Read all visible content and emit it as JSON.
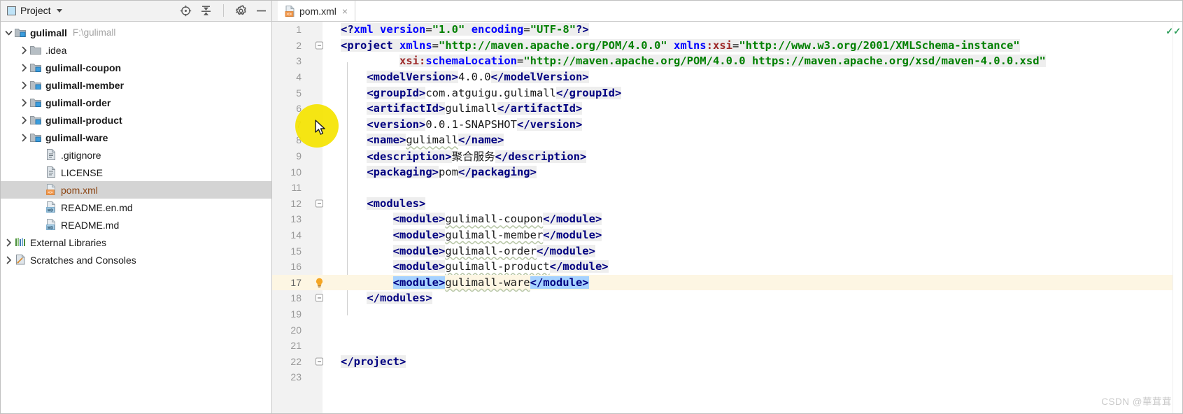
{
  "sidebar": {
    "header": {
      "title": "Project",
      "icons": [
        "locate-icon",
        "collapse-all-icon",
        "gear-icon",
        "minimize-icon"
      ]
    },
    "items": [
      {
        "label": "gulimall",
        "path": "F:\\gulimall",
        "icon": "module-folder-icon",
        "arrow": "expanded",
        "depth": 0,
        "bold": true,
        "selected": false
      },
      {
        "label": ".idea",
        "path": "",
        "icon": "folder-icon",
        "arrow": "collapsed",
        "depth": 1,
        "bold": false,
        "selected": false
      },
      {
        "label": "gulimall-coupon",
        "path": "",
        "icon": "module-folder-icon",
        "arrow": "collapsed",
        "depth": 1,
        "bold": true,
        "selected": false
      },
      {
        "label": "gulimall-member",
        "path": "",
        "icon": "module-folder-icon",
        "arrow": "collapsed",
        "depth": 1,
        "bold": true,
        "selected": false
      },
      {
        "label": "gulimall-order",
        "path": "",
        "icon": "module-folder-icon",
        "arrow": "collapsed",
        "depth": 1,
        "bold": true,
        "selected": false
      },
      {
        "label": "gulimall-product",
        "path": "",
        "icon": "module-folder-icon",
        "arrow": "collapsed",
        "depth": 1,
        "bold": true,
        "selected": false
      },
      {
        "label": "gulimall-ware",
        "path": "",
        "icon": "module-folder-icon",
        "arrow": "collapsed",
        "depth": 1,
        "bold": true,
        "selected": false
      },
      {
        "label": ".gitignore",
        "path": "",
        "icon": "text-file-icon",
        "arrow": "none",
        "depth": 2,
        "bold": false,
        "selected": false
      },
      {
        "label": "LICENSE",
        "path": "",
        "icon": "text-file-icon",
        "arrow": "none",
        "depth": 2,
        "bold": false,
        "selected": false
      },
      {
        "label": "pom.xml",
        "path": "",
        "icon": "xml-file-icon",
        "arrow": "none",
        "depth": 2,
        "bold": false,
        "selected": true
      },
      {
        "label": "README.en.md",
        "path": "",
        "icon": "markdown-file-icon",
        "arrow": "none",
        "depth": 2,
        "bold": false,
        "selected": false
      },
      {
        "label": "README.md",
        "path": "",
        "icon": "markdown-file-icon",
        "arrow": "none",
        "depth": 2,
        "bold": false,
        "selected": false
      },
      {
        "label": "External Libraries",
        "path": "",
        "icon": "libraries-icon",
        "arrow": "collapsed",
        "depth": 0,
        "bold": false,
        "selected": false
      },
      {
        "label": "Scratches and Consoles",
        "path": "",
        "icon": "scratches-icon",
        "arrow": "collapsed",
        "depth": 0,
        "bold": false,
        "selected": false
      }
    ]
  },
  "editor": {
    "tab": {
      "label": "pom.xml",
      "icon": "xml-file-icon",
      "close": "×"
    },
    "current_line": 17,
    "inspection_ok_marker": "✓✓",
    "lines": [
      {
        "n": 1,
        "fold": false,
        "bulb": false,
        "indent": 0,
        "tokens": [
          {
            "t": "<?",
            "c": "t-pi",
            "bg": "hl"
          },
          {
            "t": "xml",
            "c": "t-attr",
            "bg": "hl"
          },
          {
            "t": " ",
            "c": "t-txt",
            "bg": "hl"
          },
          {
            "t": "version",
            "c": "t-attr",
            "bg": "hl"
          },
          {
            "t": "=",
            "c": "t-txt",
            "bg": "hl"
          },
          {
            "t": "\"1.0\"",
            "c": "t-val",
            "bg": "hl"
          },
          {
            "t": " ",
            "c": "t-txt",
            "bg": "hl"
          },
          {
            "t": "encoding",
            "c": "t-attr",
            "bg": "hl"
          },
          {
            "t": "=",
            "c": "t-txt",
            "bg": "hl"
          },
          {
            "t": "\"UTF-8\"",
            "c": "t-val",
            "bg": "hl"
          },
          {
            "t": "?>",
            "c": "t-pi",
            "bg": "hl"
          }
        ]
      },
      {
        "n": 2,
        "fold": true,
        "bulb": false,
        "indent": 0,
        "tokens": [
          {
            "t": "<project",
            "c": "t-tag",
            "bg": "hl"
          },
          {
            "t": " ",
            "c": "t-txt",
            "bg": "hl"
          },
          {
            "t": "xmlns",
            "c": "t-attr",
            "bg": "hl"
          },
          {
            "t": "=",
            "c": "t-txt",
            "bg": "hl"
          },
          {
            "t": "\"http://maven.apache.org/POM/4.0.0\"",
            "c": "t-val",
            "bg": "hl"
          },
          {
            "t": " ",
            "c": "t-txt",
            "bg": "hl"
          },
          {
            "t": "xmlns",
            "c": "t-attr",
            "bg": "hl"
          },
          {
            "t": ":",
            "c": "t-ns",
            "bg": "hl"
          },
          {
            "t": "xsi",
            "c": "t-ns",
            "bg": "hl"
          },
          {
            "t": "=",
            "c": "t-txt",
            "bg": "hl"
          },
          {
            "t": "\"http://www.w3.org/2001/XMLSchema-instance\"",
            "c": "t-val",
            "bg": "hl"
          }
        ]
      },
      {
        "n": 3,
        "fold": false,
        "bulb": false,
        "indent": 0,
        "tokens": [
          {
            "t": "         ",
            "c": "t-txt",
            "bg": ""
          },
          {
            "t": "xsi",
            "c": "t-ns",
            "bg": "hl"
          },
          {
            "t": ":",
            "c": "t-ns",
            "bg": "hl"
          },
          {
            "t": "schemaLocation",
            "c": "t-attr",
            "bg": "hl"
          },
          {
            "t": "=",
            "c": "t-txt",
            "bg": "hl"
          },
          {
            "t": "\"http://maven.apache.org/POM/4.0.0 https://maven.apache.org/xsd/maven-4.0.0.xsd\"",
            "c": "t-val",
            "bg": "hl"
          }
        ]
      },
      {
        "n": 4,
        "fold": false,
        "bulb": false,
        "indent": 0,
        "tokens": [
          {
            "t": "    ",
            "c": "t-txt",
            "bg": ""
          },
          {
            "t": "<modelVersion>",
            "c": "t-tag",
            "bg": "hl"
          },
          {
            "t": "4.0.0",
            "c": "t-txt",
            "bg": ""
          },
          {
            "t": "</modelVersion>",
            "c": "t-tag",
            "bg": "hl"
          }
        ]
      },
      {
        "n": 5,
        "fold": false,
        "bulb": false,
        "indent": 0,
        "tokens": [
          {
            "t": "    ",
            "c": "t-txt",
            "bg": ""
          },
          {
            "t": "<groupId>",
            "c": "t-tag",
            "bg": "hl"
          },
          {
            "t": "com.atguigu.gulimall",
            "c": "t-txt",
            "bg": ""
          },
          {
            "t": "</groupId>",
            "c": "t-tag",
            "bg": "hl"
          }
        ]
      },
      {
        "n": 6,
        "fold": false,
        "bulb": false,
        "indent": 0,
        "tokens": [
          {
            "t": "    ",
            "c": "t-txt",
            "bg": ""
          },
          {
            "t": "<artifactId>",
            "c": "t-tag",
            "bg": "hl"
          },
          {
            "t": "gulimall",
            "c": "t-txt",
            "bg": ""
          },
          {
            "t": "</artifactId>",
            "c": "t-tag",
            "bg": "hl"
          }
        ]
      },
      {
        "n": 7,
        "fold": false,
        "bulb": false,
        "indent": 0,
        "tokens": [
          {
            "t": "    ",
            "c": "t-txt",
            "bg": ""
          },
          {
            "t": "<version>",
            "c": "t-tag",
            "bg": "hl"
          },
          {
            "t": "0.0.1-SNAPSHOT",
            "c": "t-txt",
            "bg": ""
          },
          {
            "t": "</version>",
            "c": "t-tag",
            "bg": "hl"
          }
        ]
      },
      {
        "n": 8,
        "fold": false,
        "bulb": false,
        "indent": 1,
        "tokens": [
          {
            "t": "    ",
            "c": "t-txt",
            "bg": ""
          },
          {
            "t": "<name>",
            "c": "t-tag",
            "bg": "hl"
          },
          {
            "t": "gulimall",
            "c": "t-txt wavy",
            "bg": ""
          },
          {
            "t": "</name>",
            "c": "t-tag",
            "bg": "hl"
          }
        ]
      },
      {
        "n": 9,
        "fold": false,
        "bulb": false,
        "indent": 0,
        "tokens": [
          {
            "t": "    ",
            "c": "t-txt",
            "bg": ""
          },
          {
            "t": "<description>",
            "c": "t-tag",
            "bg": "hl"
          },
          {
            "t": "聚合服务",
            "c": "t-txt",
            "bg": ""
          },
          {
            "t": "</description>",
            "c": "t-tag",
            "bg": "hl"
          }
        ]
      },
      {
        "n": 10,
        "fold": false,
        "bulb": false,
        "indent": 0,
        "tokens": [
          {
            "t": "    ",
            "c": "t-txt",
            "bg": ""
          },
          {
            "t": "<packaging>",
            "c": "t-tag",
            "bg": "hl"
          },
          {
            "t": "pom",
            "c": "t-txt",
            "bg": ""
          },
          {
            "t": "</packaging>",
            "c": "t-tag",
            "bg": "hl"
          }
        ]
      },
      {
        "n": 11,
        "fold": false,
        "bulb": false,
        "indent": 0,
        "tokens": []
      },
      {
        "n": 12,
        "fold": true,
        "bulb": false,
        "indent": 0,
        "tokens": [
          {
            "t": "    ",
            "c": "t-txt",
            "bg": ""
          },
          {
            "t": "<modules>",
            "c": "t-tag",
            "bg": "hl"
          }
        ]
      },
      {
        "n": 13,
        "fold": false,
        "bulb": false,
        "indent": 0,
        "tokens": [
          {
            "t": "        ",
            "c": "t-txt",
            "bg": ""
          },
          {
            "t": "<module>",
            "c": "t-tag",
            "bg": "hl"
          },
          {
            "t": "gulimall-coupon",
            "c": "t-txt wavy",
            "bg": ""
          },
          {
            "t": "</module>",
            "c": "t-tag",
            "bg": "hl"
          }
        ]
      },
      {
        "n": 14,
        "fold": false,
        "bulb": false,
        "indent": 0,
        "tokens": [
          {
            "t": "        ",
            "c": "t-txt",
            "bg": ""
          },
          {
            "t": "<module>",
            "c": "t-tag",
            "bg": "hl"
          },
          {
            "t": "gulimall-member",
            "c": "t-txt wavy",
            "bg": ""
          },
          {
            "t": "</module>",
            "c": "t-tag",
            "bg": "hl"
          }
        ]
      },
      {
        "n": 15,
        "fold": false,
        "bulb": false,
        "indent": 0,
        "tokens": [
          {
            "t": "        ",
            "c": "t-txt",
            "bg": ""
          },
          {
            "t": "<module>",
            "c": "t-tag",
            "bg": "hl"
          },
          {
            "t": "gulimall-order",
            "c": "t-txt wavy",
            "bg": ""
          },
          {
            "t": "</module>",
            "c": "t-tag",
            "bg": "hl"
          }
        ]
      },
      {
        "n": 16,
        "fold": false,
        "bulb": false,
        "indent": 0,
        "tokens": [
          {
            "t": "        ",
            "c": "t-txt",
            "bg": ""
          },
          {
            "t": "<module>",
            "c": "t-tag",
            "bg": "hl"
          },
          {
            "t": "gulimall-product",
            "c": "t-txt wavy",
            "bg": ""
          },
          {
            "t": "</module>",
            "c": "t-tag",
            "bg": "hl"
          }
        ]
      },
      {
        "n": 17,
        "fold": false,
        "bulb": true,
        "indent": 0,
        "tokens": [
          {
            "t": "        ",
            "c": "t-txt",
            "bg": ""
          },
          {
            "t": "<module>",
            "c": "t-tag",
            "bg": "selblue"
          },
          {
            "t": "gulimall-ware",
            "c": "t-txt wavy",
            "bg": ""
          },
          {
            "t": "</module>",
            "c": "t-tag",
            "bg": "selblue"
          }
        ]
      },
      {
        "n": 18,
        "fold": true,
        "bulb": false,
        "indent": 0,
        "tokens": [
          {
            "t": "    ",
            "c": "t-txt",
            "bg": ""
          },
          {
            "t": "</modules>",
            "c": "t-tag",
            "bg": "hl"
          }
        ]
      },
      {
        "n": 19,
        "fold": false,
        "bulb": false,
        "indent": 0,
        "tokens": []
      },
      {
        "n": 20,
        "fold": false,
        "bulb": false,
        "indent": 0,
        "tokens": []
      },
      {
        "n": 21,
        "fold": false,
        "bulb": false,
        "indent": 0,
        "tokens": []
      },
      {
        "n": 22,
        "fold": true,
        "bulb": false,
        "indent": 0,
        "tokens": [
          {
            "t": "</project>",
            "c": "t-tag",
            "bg": "hl"
          }
        ]
      },
      {
        "n": 23,
        "fold": false,
        "bulb": false,
        "indent": 0,
        "tokens": []
      }
    ]
  },
  "watermark": "CSDN @華茸茸",
  "colors": {
    "tag": "#000080",
    "attribute": "#0000ff",
    "namespace": "#9e2a2a",
    "value": "#008000",
    "selection": "#a6d2ff",
    "current_line": "#fdf6e3",
    "tree_selection": "#d4d4d4",
    "cursor_highlight": "#f5e400"
  }
}
